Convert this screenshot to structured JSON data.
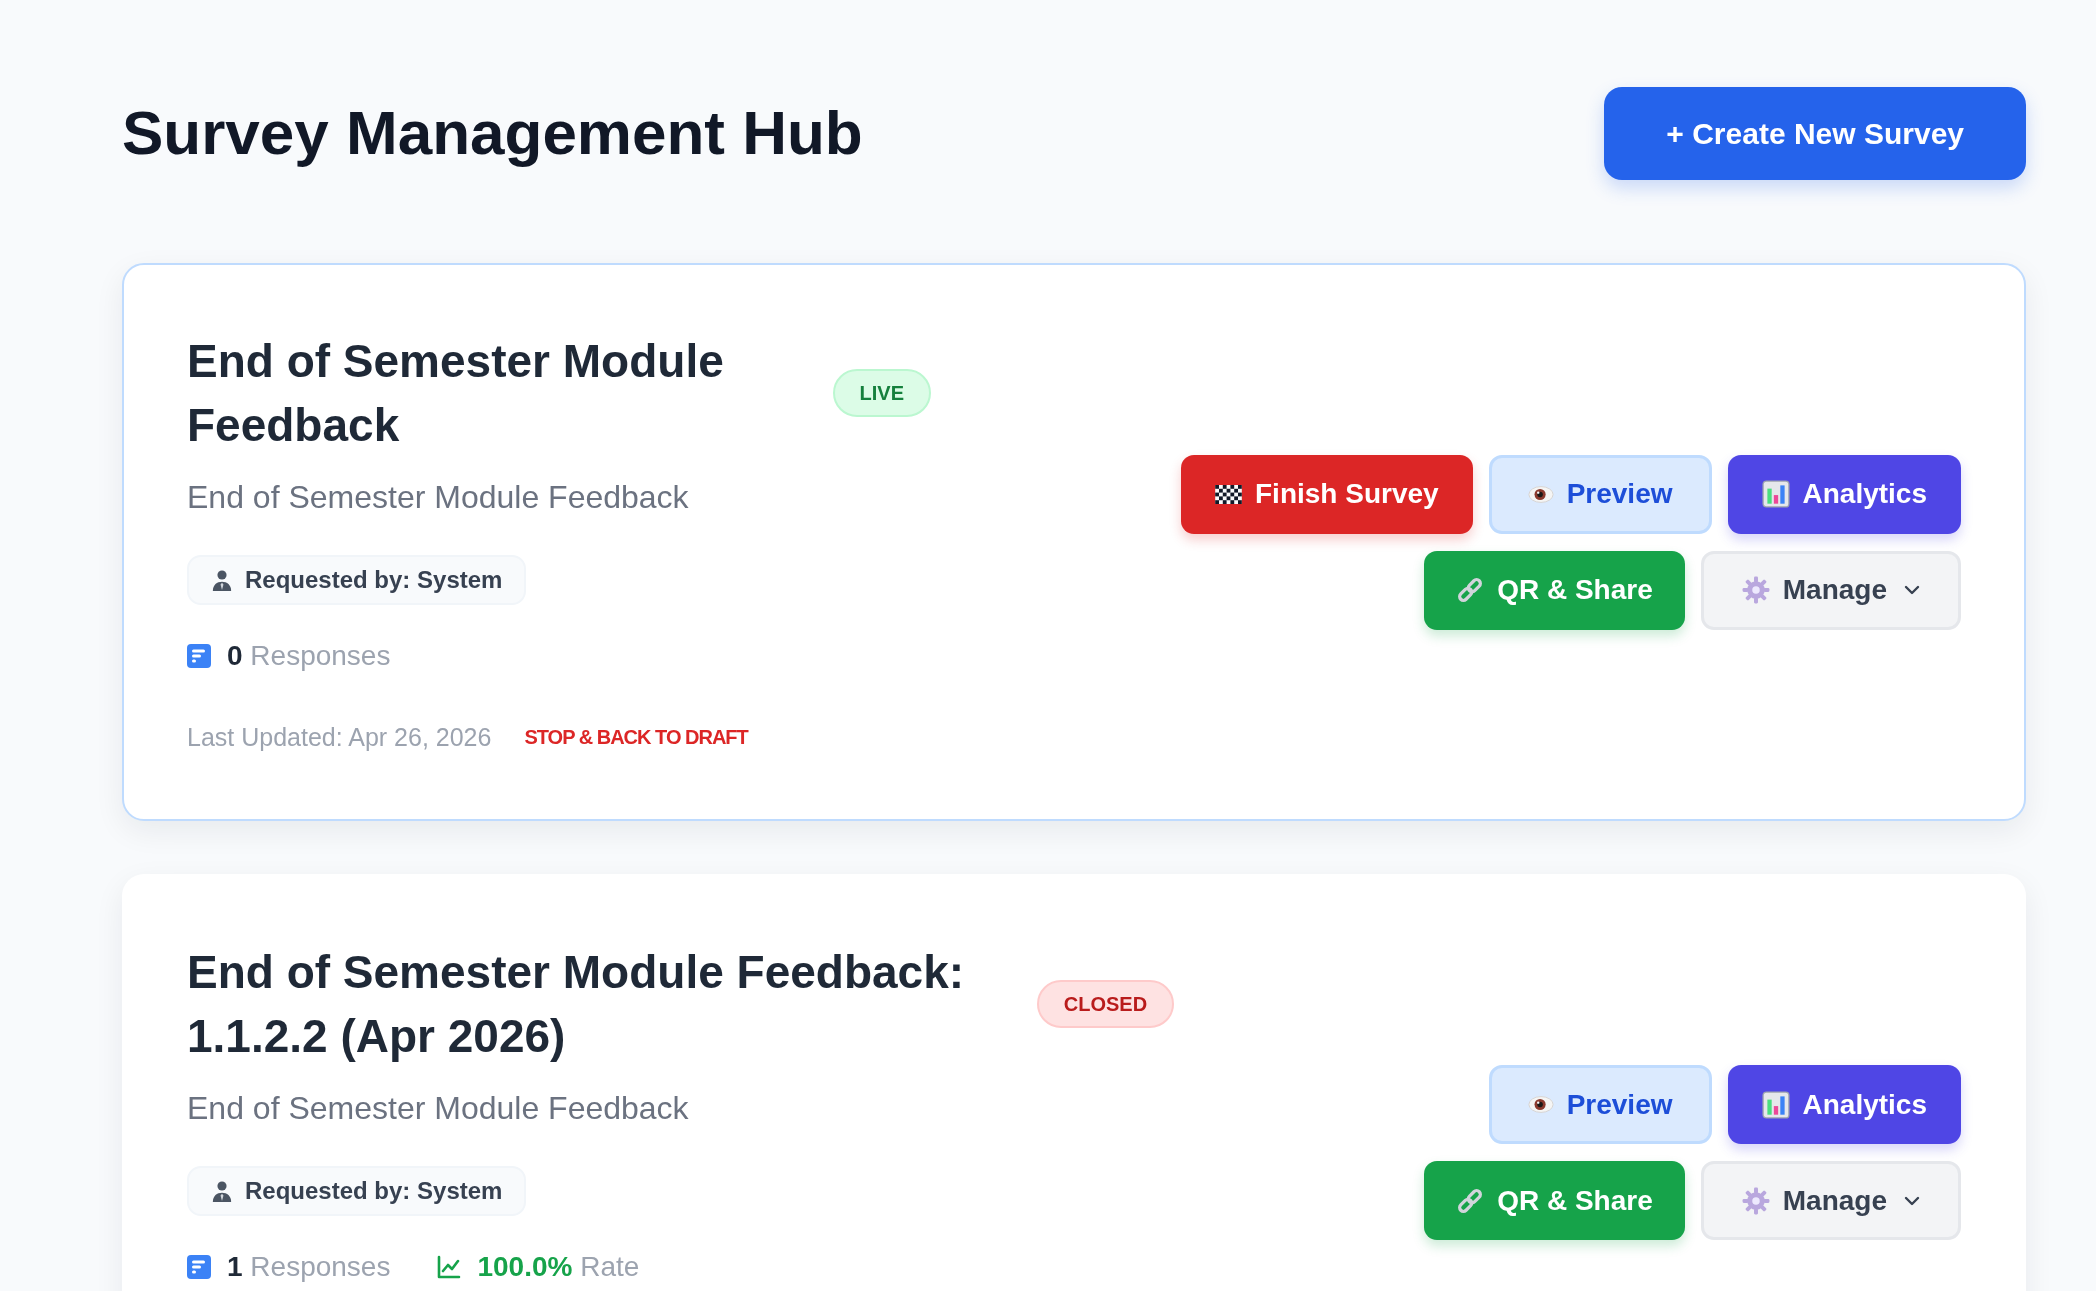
{
  "header": {
    "title": "Survey Management Hub",
    "create_button": {
      "label": "+ Create New Survey"
    }
  },
  "surveys": [
    {
      "title": "End of Semester Module Feedback",
      "highlighted": true,
      "status": {
        "label": "LIVE",
        "kind": "live"
      },
      "description": "End of Semester Module Feedback",
      "requested_by": "Requested by: System",
      "stats": [
        {
          "kind": "responses",
          "text": "**0** Responses"
        }
      ],
      "footer": {
        "updated": "Last Updated: Apr 26, 2026",
        "link": "STOP & BACK TO DRAFT"
      },
      "action_rows": [
        [
          {
            "label": "Finish Survey",
            "kind": "finish"
          },
          {
            "label": "Preview",
            "kind": "preview"
          },
          {
            "label": "Analytics",
            "kind": "analytics"
          }
        ],
        [
          {
            "label": "QR & Share",
            "kind": "share"
          },
          {
            "label": "Manage",
            "kind": "manage"
          }
        ]
      ]
    },
    {
      "title": "End of Semester Module Feedback: 1.1.2.2 (Apr 2026)",
      "highlighted": false,
      "status": {
        "label": "CLOSED",
        "kind": "closed"
      },
      "description": "End of Semester Module Feedback",
      "requested_by": "Requested by: System",
      "stats": [
        {
          "kind": "responses",
          "text": "**1** Responses"
        },
        {
          "kind": "rate",
          "text": "**100.0%** Rate"
        }
      ],
      "action_rows": [
        [
          {
            "label": "Preview",
            "kind": "preview"
          },
          {
            "label": "Analytics",
            "kind": "analytics"
          }
        ],
        [
          {
            "label": "QR & Share",
            "kind": "share"
          },
          {
            "label": "Manage",
            "kind": "manage"
          }
        ]
      ]
    }
  ]
}
